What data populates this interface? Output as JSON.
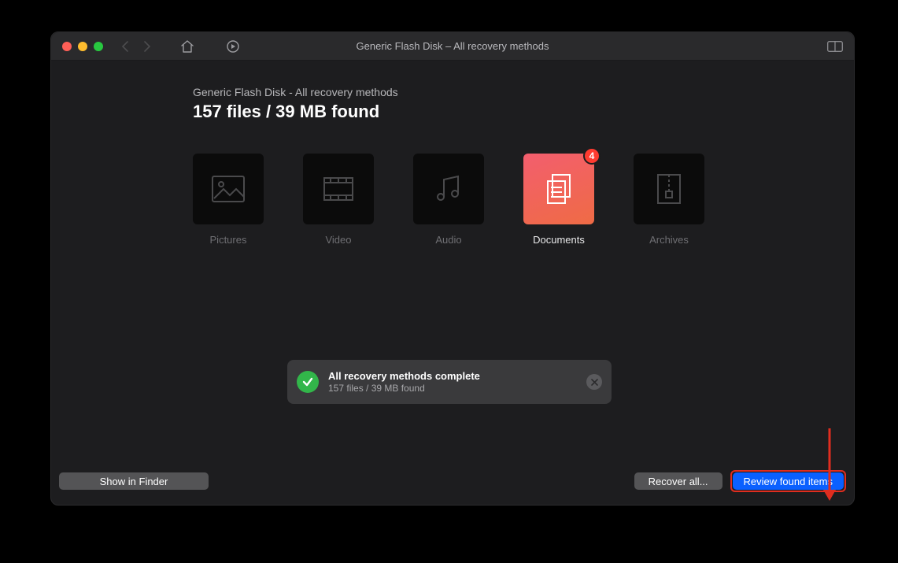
{
  "window": {
    "title": "Generic Flash Disk – All recovery methods"
  },
  "header": {
    "subtitle": "Generic Flash Disk - All recovery methods",
    "summary": "157 files / 39 MB found"
  },
  "categories": [
    {
      "id": "pictures",
      "label": "Pictures",
      "active": false
    },
    {
      "id": "video",
      "label": "Video",
      "active": false
    },
    {
      "id": "audio",
      "label": "Audio",
      "active": false
    },
    {
      "id": "documents",
      "label": "Documents",
      "active": true,
      "badge": 4
    },
    {
      "id": "archives",
      "label": "Archives",
      "active": false
    }
  ],
  "toast": {
    "title": "All recovery methods complete",
    "sub": "157 files / 39 MB found"
  },
  "footer": {
    "show_in_finder": "Show in Finder",
    "recover_all": "Recover all...",
    "review": "Review found items"
  }
}
